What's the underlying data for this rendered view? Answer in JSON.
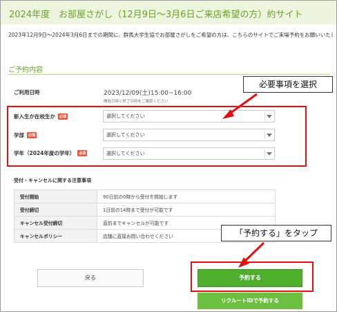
{
  "header": {
    "title": "2024年度　お部屋さがし（12月9日～3月6日ご来店希望の方）約サイト"
  },
  "intro": {
    "text": "2023年12月9日～2024年3月6日までの期間に、群馬大学生協でお部屋さがしをご希望の方は、こちらのサイトでご来場予約をお願いいたします"
  },
  "reservation": {
    "section_title": "ご予約内容",
    "date_label": "ご利用日時",
    "date_value": "2023/12/09(土)15:00~16:00",
    "date_note": "開始日時と終了日時をご確認ください",
    "required_badge": "必須",
    "fields": [
      {
        "label": "新入生か在校生か",
        "placeholder": "選択してください"
      },
      {
        "label": "学部",
        "placeholder": "選択してください"
      },
      {
        "label": "学年（2024年度の学年）",
        "placeholder": "選択してください"
      }
    ]
  },
  "policy": {
    "heading": "受付・キャンセルに関する注意事項",
    "rows": [
      {
        "key": "受付開始",
        "value": "90日前の0時から受付を開始します"
      },
      {
        "key": "受付締切",
        "value": "1日前の14時まで受付が可能です"
      },
      {
        "key": "キャンセル受付締切",
        "value": "直前までキャンセルが可能です"
      },
      {
        "key": "キャンセルポリシー",
        "value": "店舗に直接お問い合わせください"
      }
    ]
  },
  "buttons": {
    "back": "戻る",
    "reserve": "予約する",
    "recruit": "リクルートIDで予約する"
  },
  "annotations": {
    "select_callout": "必要事項を選択",
    "tap_callout": "「予約する」をタップ"
  },
  "colors": {
    "accent_green": "#6aa12a",
    "button_green": "#4fae2e",
    "highlight_red": "#e01010",
    "required_red": "#e8573e"
  }
}
